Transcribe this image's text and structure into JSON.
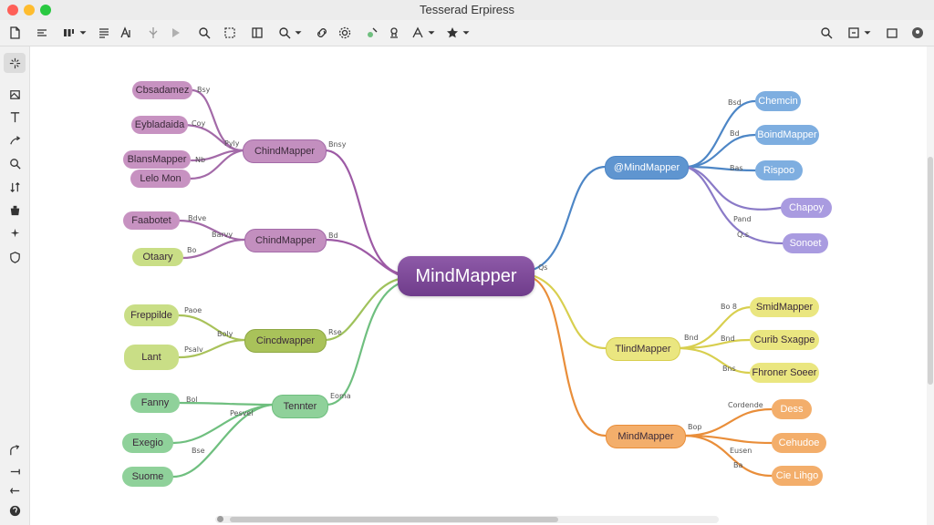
{
  "window": {
    "title": "Tesserad Erpiress"
  },
  "central": {
    "label": "MindMapper"
  },
  "branches": {
    "purple_top": {
      "label": "ChindMapper",
      "leaves": [
        "Cbsadamez",
        "Eybladaida",
        "BlansMapper",
        "Lelo Mon"
      ]
    },
    "purple_mid": {
      "label": "ChindMapper",
      "leaves": [
        "Faabotet",
        "Otaary"
      ]
    },
    "lime": {
      "label": "Cincdwapper",
      "leaves": [
        "Freppilde",
        "Lant"
      ]
    },
    "green": {
      "label": "Tennter",
      "leaves": [
        "Fanny",
        "Exegio",
        "Suome"
      ]
    },
    "blue": {
      "label": "@MindMapper",
      "leaves": [
        "Chemcin",
        "BoindMapper",
        "Rispoo"
      ]
    },
    "violet": {
      "leaves": [
        "Chapoy",
        "Sonoet"
      ]
    },
    "yellow": {
      "label": "TlindMapper",
      "leaves": [
        "SmidMapper",
        "Curib Sxagpe",
        "Fhroner Soeer"
      ]
    },
    "orange": {
      "label": "MindMapper",
      "leaves": [
        "Dess",
        "Cehudoe",
        "Cie Lihgo"
      ]
    }
  },
  "annotations": {
    "a1": "Bsy",
    "a2": "Coy",
    "a3": "Nb",
    "a4": "Pyly",
    "a5": "Bnsy",
    "a6": "Bdve",
    "a7": "Bo",
    "a8": "Barvy",
    "a9": "Bd",
    "a10": "Paoe",
    "a11": "Psalv",
    "a12": "Boly",
    "a13": "Rse",
    "a14": "Bol",
    "a15": "Bse",
    "a16": "Eoma",
    "a17": "Pesvel",
    "a18": "Qs",
    "a19": "Bsd",
    "a20": "Bd",
    "a21": "Bas",
    "a22": "Pand",
    "a23": "Q.s",
    "a24": "Bo 8",
    "a25": "Bnd",
    "a26": "Bns",
    "a27": "Bnd",
    "a28": "Bop",
    "a29": "Cordende",
    "a30": "Eusen",
    "a31": "Ba"
  },
  "colors": {
    "purple": "#a36aa8",
    "purple_fill": "#c792c1",
    "lime": "#a9c25a",
    "lime_fill": "#c9de86",
    "green": "#6fbf7f",
    "green_fill": "#8fd19a",
    "blue": "#4d86c6",
    "blue_fill": "#7eaee0",
    "violet": "#8a7ac7",
    "violet_fill": "#a99be0",
    "yellow": "#d8cf4f",
    "yellow_fill": "#eae680",
    "orange": "#e98e3a",
    "orange_fill": "#f3ae6b",
    "accent": "#3b82f6"
  },
  "toolbar_icons": [
    "new-document-icon",
    "outline-icon",
    "layout-icon",
    "list-icon",
    "style-icon",
    "pin-icon",
    "play-icon",
    "search-icon",
    "select-icon",
    "sidebar-icon",
    "zoom-icon",
    "link-icon",
    "settings-icon",
    "plugin-icon",
    "stamp-icon",
    "text-style-icon",
    "star-icon",
    "search-icon",
    "export-icon",
    "account-icon"
  ],
  "sidebar_icons": [
    "magic-wand-icon",
    "image-icon",
    "text-icon",
    "arrow-icon",
    "search-icon",
    "sort-icon",
    "bucket-icon",
    "sparkle-icon",
    "shield-icon",
    "curve-icon",
    "align-icon",
    "indent-icon",
    "help-icon"
  ]
}
